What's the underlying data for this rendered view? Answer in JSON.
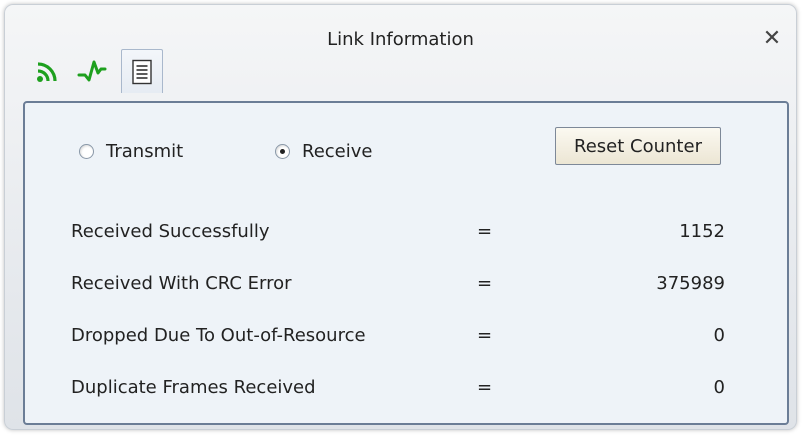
{
  "window": {
    "title": "Link Information",
    "close_glyph": "✕"
  },
  "tabs": [
    {
      "icon": "signal-strength-icon",
      "color": "#1ea01e"
    },
    {
      "icon": "link-quality-wave-icon",
      "color": "#1ea01e"
    },
    {
      "icon": "document-list-icon",
      "selected": true
    }
  ],
  "mode": {
    "transmit_label": "Transmit",
    "receive_label": "Receive",
    "selected": "Receive"
  },
  "reset_button_label": "Reset Counter",
  "stats": [
    {
      "label": "Received Successfully",
      "eq": "=",
      "value": "1152"
    },
    {
      "label": "Received With CRC Error",
      "eq": "=",
      "value": "375989"
    },
    {
      "label": "Dropped Due To Out-of-Resource",
      "eq": "=",
      "value": "0"
    },
    {
      "label": "Duplicate Frames Received",
      "eq": "=",
      "value": "0"
    }
  ],
  "colors": {
    "panel_border": "#6b7d96",
    "panel_background": "#eef3f8",
    "icon_green": "#1ea01e"
  }
}
